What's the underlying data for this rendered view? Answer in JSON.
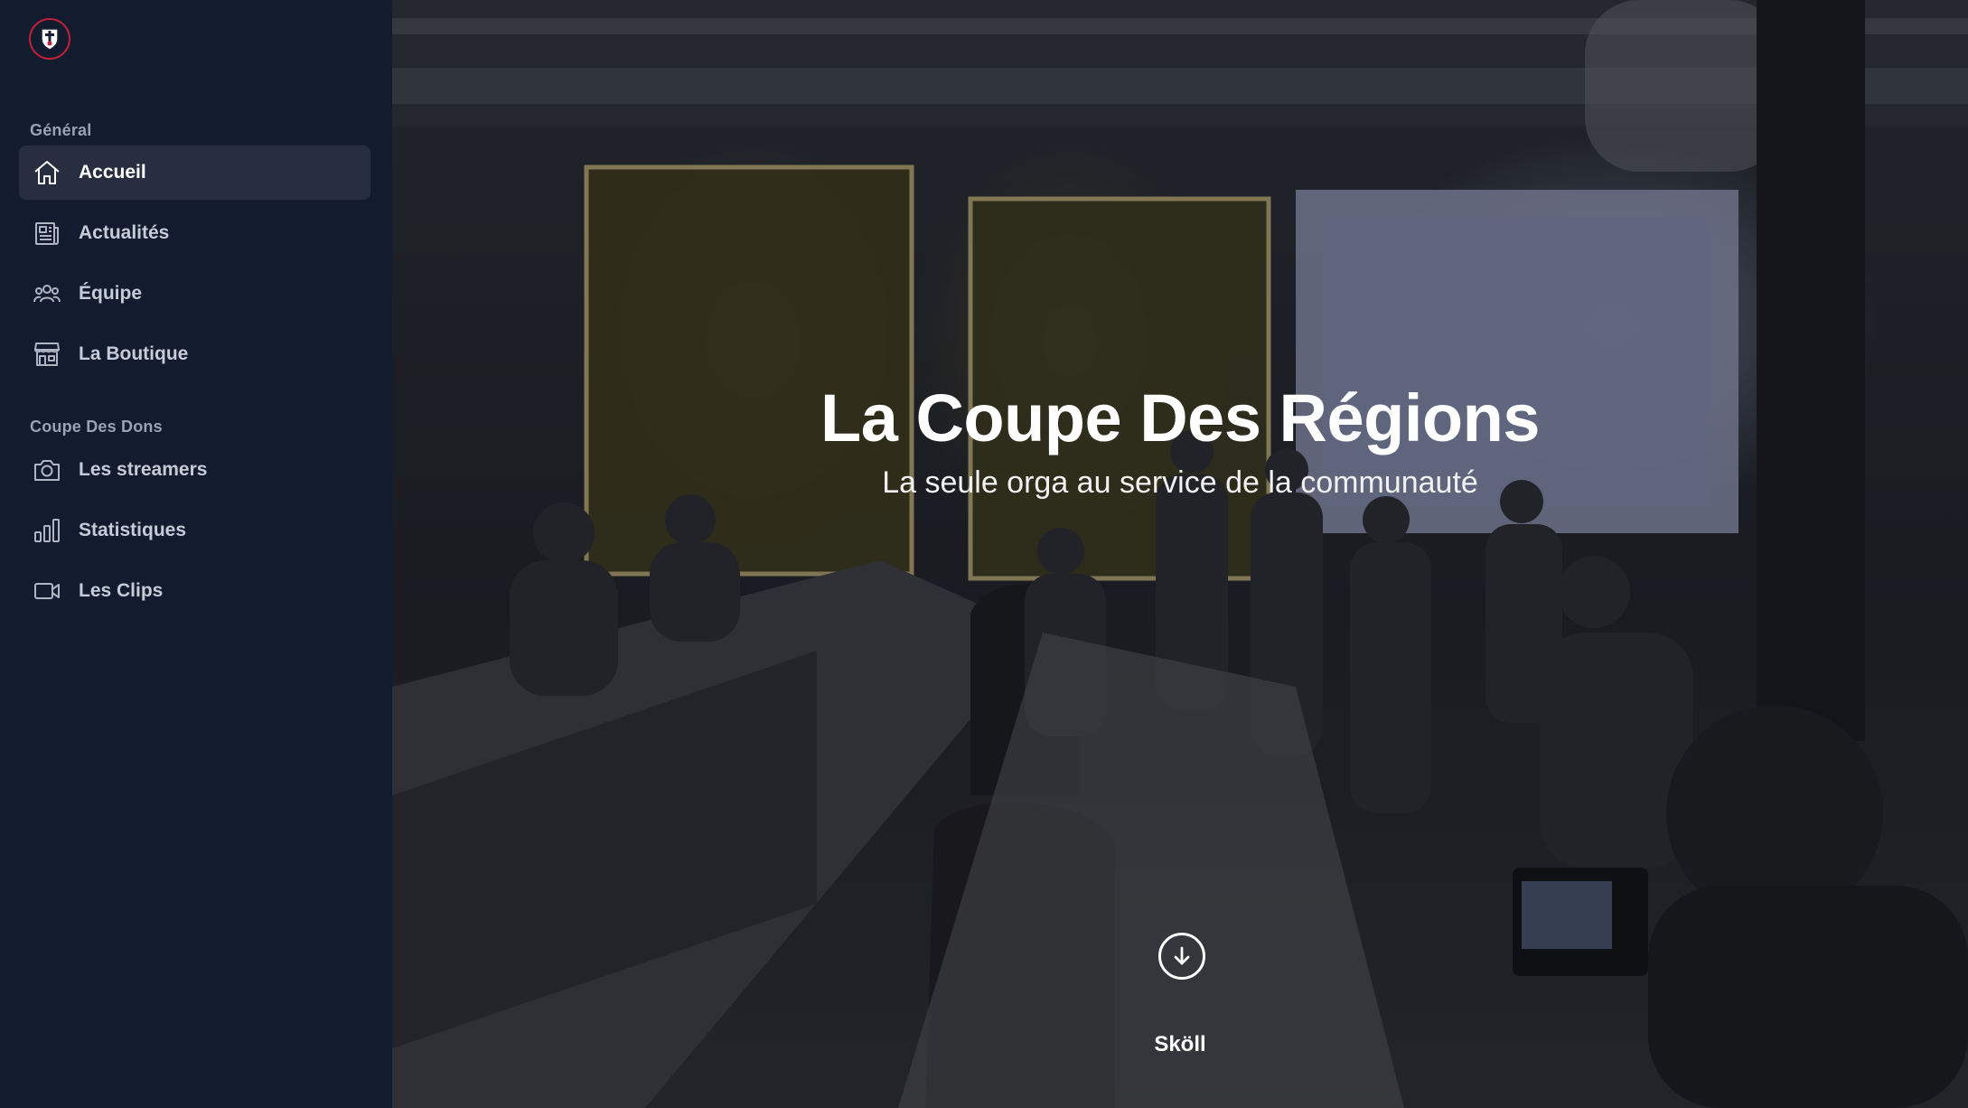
{
  "sidebar": {
    "logo_icon": "shield-crest-icon",
    "sections": [
      {
        "title": "Général",
        "items": [
          {
            "label": "Accueil",
            "icon": "home-icon",
            "active": true
          },
          {
            "label": "Actualités",
            "icon": "newspaper-icon",
            "active": false
          },
          {
            "label": "Équipe",
            "icon": "users-icon",
            "active": false
          },
          {
            "label": "La Boutique",
            "icon": "storefront-icon",
            "active": false
          }
        ]
      },
      {
        "title": "Coupe Des Dons",
        "items": [
          {
            "label": "Les streamers",
            "icon": "camera-icon",
            "active": false
          },
          {
            "label": "Statistiques",
            "icon": "bar-chart-icon",
            "active": false
          },
          {
            "label": "Les Clips",
            "icon": "video-camera-icon",
            "active": false
          }
        ]
      }
    ]
  },
  "hero": {
    "title": "La Coupe Des Régions",
    "subtitle": "La seule orga au service de la communauté",
    "scroll_icon": "arrow-down-circle-icon",
    "scroll_label": "Sköll"
  },
  "colors": {
    "sidebar_bg": "#131b2e",
    "active_item_bg": "#262e40",
    "logo_ring": "#c0203a"
  }
}
